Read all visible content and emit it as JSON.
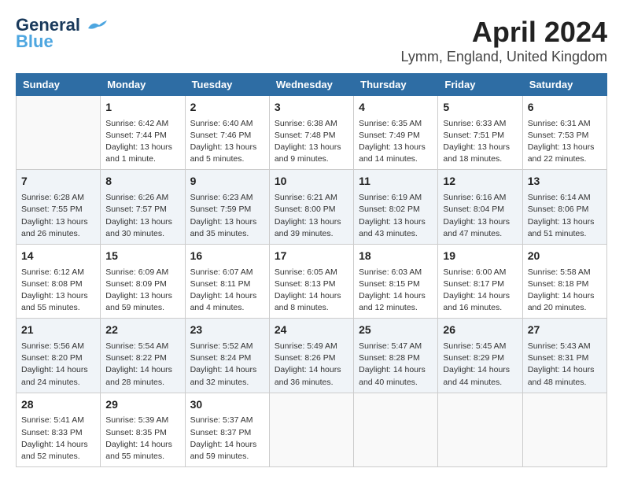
{
  "header": {
    "logo_line1": "General",
    "logo_line2": "Blue",
    "title": "April 2024",
    "subtitle": "Lymm, England, United Kingdom"
  },
  "weekdays": [
    "Sunday",
    "Monday",
    "Tuesday",
    "Wednesday",
    "Thursday",
    "Friday",
    "Saturday"
  ],
  "weeks": [
    [
      {
        "day": "",
        "detail": ""
      },
      {
        "day": "1",
        "detail": "Sunrise: 6:42 AM\nSunset: 7:44 PM\nDaylight: 13 hours\nand 1 minute."
      },
      {
        "day": "2",
        "detail": "Sunrise: 6:40 AM\nSunset: 7:46 PM\nDaylight: 13 hours\nand 5 minutes."
      },
      {
        "day": "3",
        "detail": "Sunrise: 6:38 AM\nSunset: 7:48 PM\nDaylight: 13 hours\nand 9 minutes."
      },
      {
        "day": "4",
        "detail": "Sunrise: 6:35 AM\nSunset: 7:49 PM\nDaylight: 13 hours\nand 14 minutes."
      },
      {
        "day": "5",
        "detail": "Sunrise: 6:33 AM\nSunset: 7:51 PM\nDaylight: 13 hours\nand 18 minutes."
      },
      {
        "day": "6",
        "detail": "Sunrise: 6:31 AM\nSunset: 7:53 PM\nDaylight: 13 hours\nand 22 minutes."
      }
    ],
    [
      {
        "day": "7",
        "detail": "Sunrise: 6:28 AM\nSunset: 7:55 PM\nDaylight: 13 hours\nand 26 minutes."
      },
      {
        "day": "8",
        "detail": "Sunrise: 6:26 AM\nSunset: 7:57 PM\nDaylight: 13 hours\nand 30 minutes."
      },
      {
        "day": "9",
        "detail": "Sunrise: 6:23 AM\nSunset: 7:59 PM\nDaylight: 13 hours\nand 35 minutes."
      },
      {
        "day": "10",
        "detail": "Sunrise: 6:21 AM\nSunset: 8:00 PM\nDaylight: 13 hours\nand 39 minutes."
      },
      {
        "day": "11",
        "detail": "Sunrise: 6:19 AM\nSunset: 8:02 PM\nDaylight: 13 hours\nand 43 minutes."
      },
      {
        "day": "12",
        "detail": "Sunrise: 6:16 AM\nSunset: 8:04 PM\nDaylight: 13 hours\nand 47 minutes."
      },
      {
        "day": "13",
        "detail": "Sunrise: 6:14 AM\nSunset: 8:06 PM\nDaylight: 13 hours\nand 51 minutes."
      }
    ],
    [
      {
        "day": "14",
        "detail": "Sunrise: 6:12 AM\nSunset: 8:08 PM\nDaylight: 13 hours\nand 55 minutes."
      },
      {
        "day": "15",
        "detail": "Sunrise: 6:09 AM\nSunset: 8:09 PM\nDaylight: 13 hours\nand 59 minutes."
      },
      {
        "day": "16",
        "detail": "Sunrise: 6:07 AM\nSunset: 8:11 PM\nDaylight: 14 hours\nand 4 minutes."
      },
      {
        "day": "17",
        "detail": "Sunrise: 6:05 AM\nSunset: 8:13 PM\nDaylight: 14 hours\nand 8 minutes."
      },
      {
        "day": "18",
        "detail": "Sunrise: 6:03 AM\nSunset: 8:15 PM\nDaylight: 14 hours\nand 12 minutes."
      },
      {
        "day": "19",
        "detail": "Sunrise: 6:00 AM\nSunset: 8:17 PM\nDaylight: 14 hours\nand 16 minutes."
      },
      {
        "day": "20",
        "detail": "Sunrise: 5:58 AM\nSunset: 8:18 PM\nDaylight: 14 hours\nand 20 minutes."
      }
    ],
    [
      {
        "day": "21",
        "detail": "Sunrise: 5:56 AM\nSunset: 8:20 PM\nDaylight: 14 hours\nand 24 minutes."
      },
      {
        "day": "22",
        "detail": "Sunrise: 5:54 AM\nSunset: 8:22 PM\nDaylight: 14 hours\nand 28 minutes."
      },
      {
        "day": "23",
        "detail": "Sunrise: 5:52 AM\nSunset: 8:24 PM\nDaylight: 14 hours\nand 32 minutes."
      },
      {
        "day": "24",
        "detail": "Sunrise: 5:49 AM\nSunset: 8:26 PM\nDaylight: 14 hours\nand 36 minutes."
      },
      {
        "day": "25",
        "detail": "Sunrise: 5:47 AM\nSunset: 8:28 PM\nDaylight: 14 hours\nand 40 minutes."
      },
      {
        "day": "26",
        "detail": "Sunrise: 5:45 AM\nSunset: 8:29 PM\nDaylight: 14 hours\nand 44 minutes."
      },
      {
        "day": "27",
        "detail": "Sunrise: 5:43 AM\nSunset: 8:31 PM\nDaylight: 14 hours\nand 48 minutes."
      }
    ],
    [
      {
        "day": "28",
        "detail": "Sunrise: 5:41 AM\nSunset: 8:33 PM\nDaylight: 14 hours\nand 52 minutes."
      },
      {
        "day": "29",
        "detail": "Sunrise: 5:39 AM\nSunset: 8:35 PM\nDaylight: 14 hours\nand 55 minutes."
      },
      {
        "day": "30",
        "detail": "Sunrise: 5:37 AM\nSunset: 8:37 PM\nDaylight: 14 hours\nand 59 minutes."
      },
      {
        "day": "",
        "detail": ""
      },
      {
        "day": "",
        "detail": ""
      },
      {
        "day": "",
        "detail": ""
      },
      {
        "day": "",
        "detail": ""
      }
    ]
  ]
}
